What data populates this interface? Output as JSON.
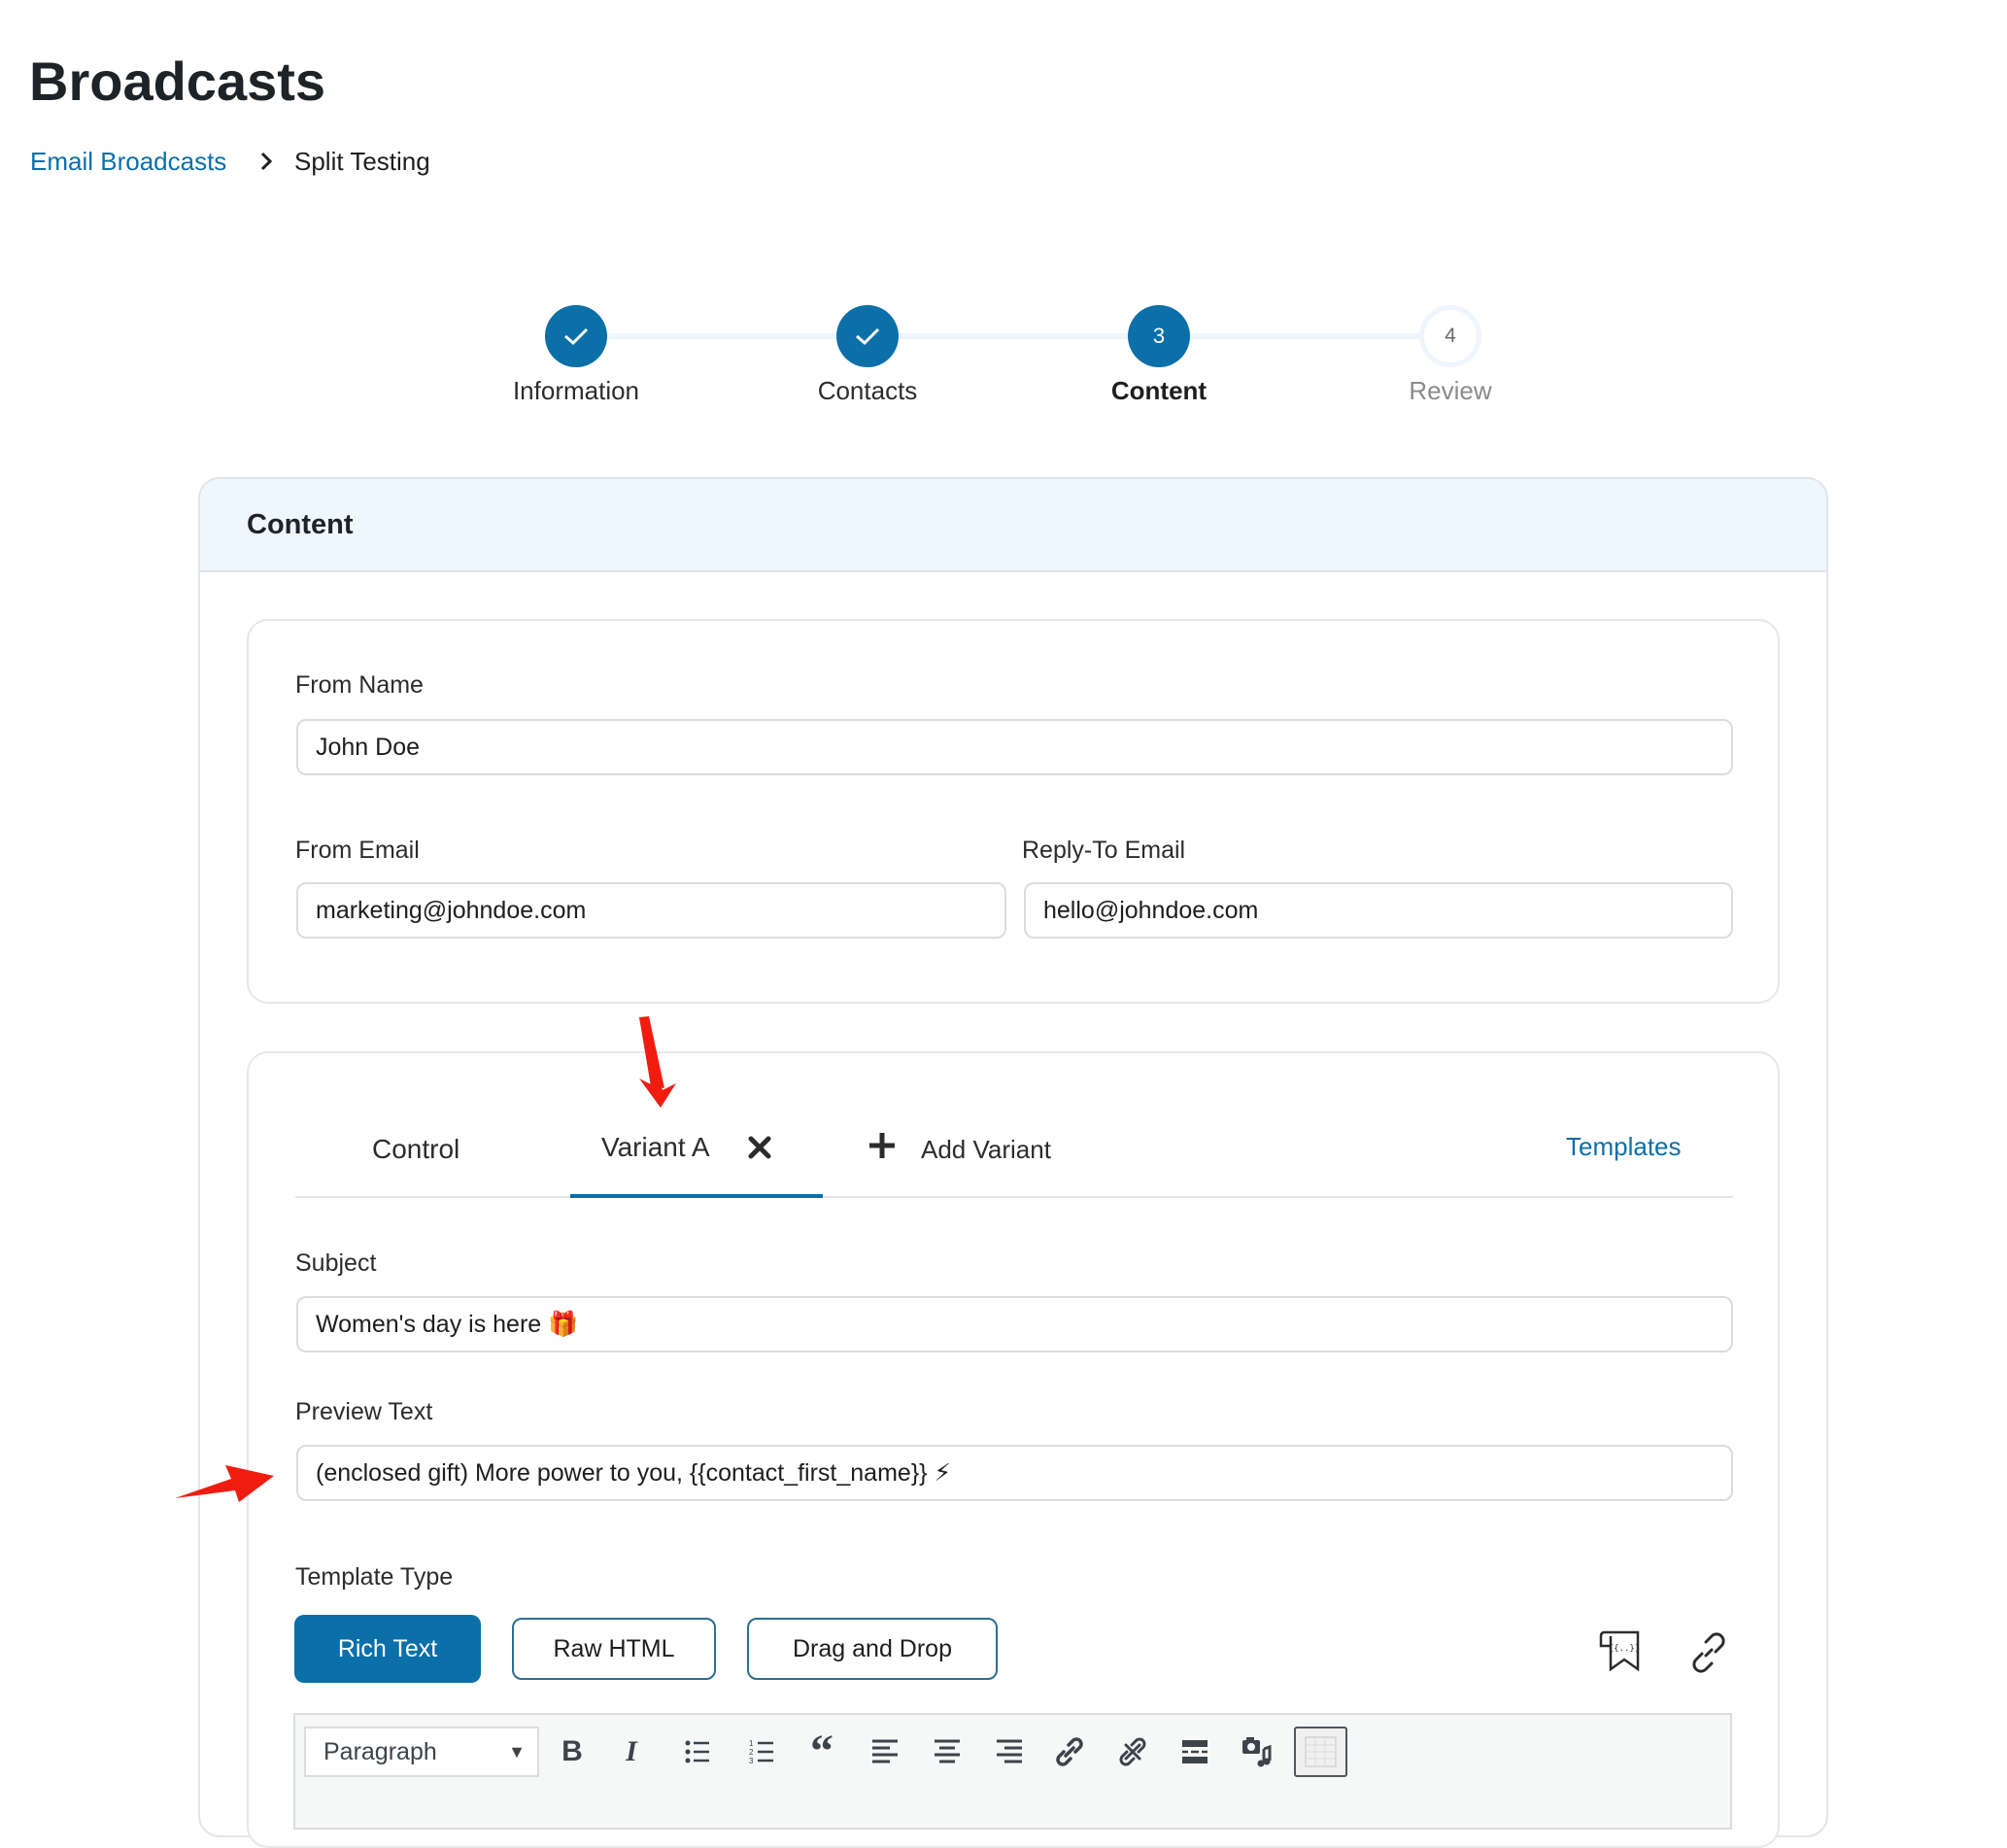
{
  "page": {
    "title": "Broadcasts"
  },
  "breadcrumb": {
    "parent": "Email Broadcasts",
    "current": "Split Testing",
    "separator_icon": "chevron-right-icon"
  },
  "stepper": {
    "steps": [
      {
        "label": "Information",
        "state": "done",
        "marker": "✓"
      },
      {
        "label": "Contacts",
        "state": "done",
        "marker": "✓"
      },
      {
        "label": "Content",
        "state": "active",
        "marker": "3"
      },
      {
        "label": "Review",
        "state": "todo",
        "marker": "4"
      }
    ]
  },
  "content_card": {
    "title": "Content",
    "sender": {
      "from_name_label": "From Name",
      "from_name_value": "John Doe",
      "from_email_label": "From Email",
      "from_email_value": "marketing@johndoe.com",
      "reply_to_label": "Reply-To Email",
      "reply_to_value": "hello@johndoe.com"
    },
    "variants": {
      "tabs": [
        {
          "label": "Control",
          "active": false
        },
        {
          "label": "Variant A",
          "active": true,
          "closable": true
        }
      ],
      "add_variant_label": "Add Variant",
      "templates_label": "Templates",
      "subject_label": "Subject",
      "subject_value": "Women's day is here 🎁",
      "preview_label": "Preview Text",
      "preview_value": "(enclosed gift) More power to you, {{contact_first_name}} ⚡",
      "template_type_label": "Template Type",
      "template_types": [
        {
          "label": "Rich Text",
          "selected": true
        },
        {
          "label": "Raw HTML",
          "selected": false
        },
        {
          "label": "Drag and Drop",
          "selected": false
        }
      ],
      "extra_icons": [
        "smart-tags-icon",
        "link-icon"
      ]
    },
    "editor_toolbar": {
      "format_value": "Paragraph",
      "buttons": [
        "bold",
        "italic",
        "bullet-list",
        "numbered-list",
        "blockquote",
        "align-left",
        "align-center",
        "align-right",
        "insert-link",
        "remove-link",
        "read-more",
        "add-media",
        "toolbar-toggle"
      ]
    }
  },
  "colors": {
    "primary": "#0b6fa8",
    "header_bg": "#eef6ff",
    "annotation_arrow": "#f01c10"
  }
}
